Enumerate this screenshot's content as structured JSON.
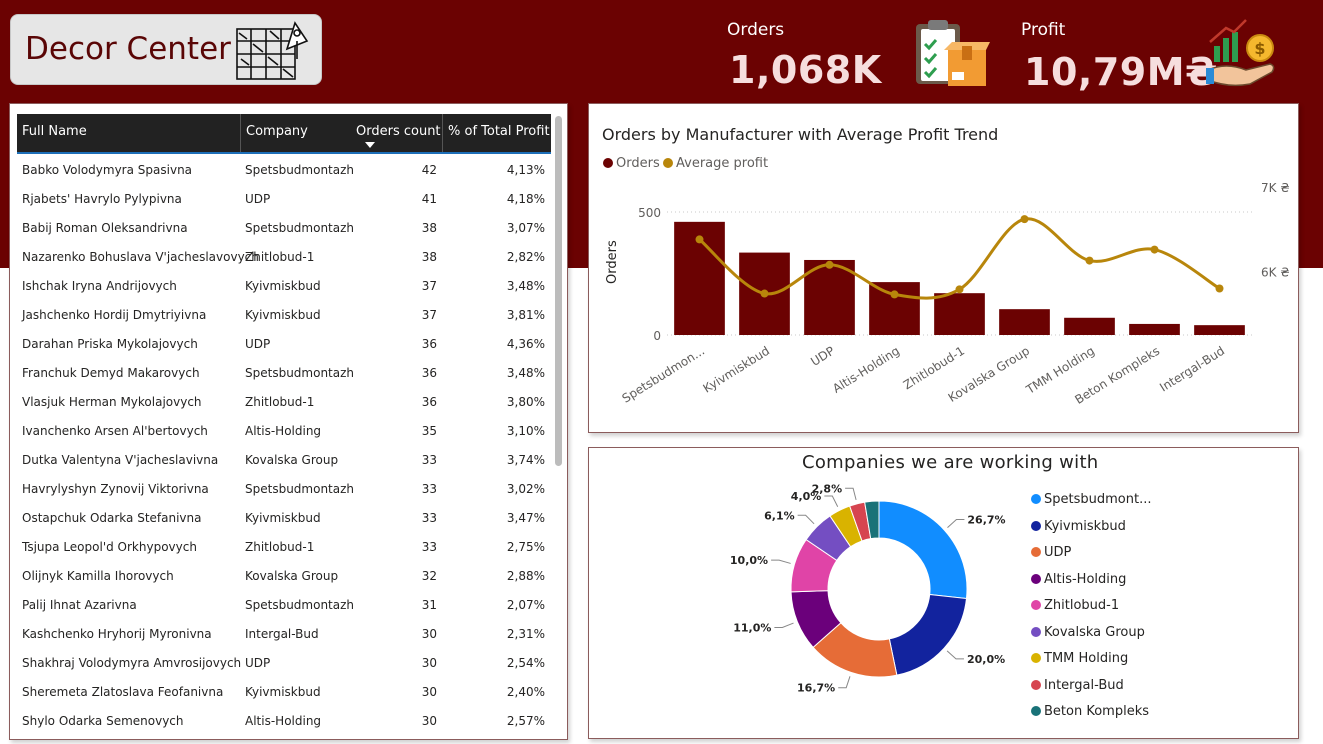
{
  "header": {
    "title": "Decor Center",
    "kpis": [
      {
        "label": "Orders",
        "value": "1,068K"
      },
      {
        "label": "Profit",
        "value": "10,79M₴"
      }
    ]
  },
  "table": {
    "columns": [
      "Full Name",
      "Company",
      "Orders count",
      "% of Total Profit"
    ],
    "rows": [
      [
        "Babko Volodymyra Spasivna",
        "Spetsbudmontazh",
        "42",
        "4,13%"
      ],
      [
        "Rjabets' Havrylo Pylypivna",
        "UDP",
        "41",
        "4,18%"
      ],
      [
        "Babij Roman Oleksandrivna",
        "Spetsbudmontazh",
        "38",
        "3,07%"
      ],
      [
        "Nazarenko Bohuslava V'jacheslavovych",
        "Zhitlobud-1",
        "38",
        "2,82%"
      ],
      [
        "Ishchak Iryna Andrijovych",
        "Kyivmiskbud",
        "37",
        "3,48%"
      ],
      [
        "Jashchenko Hordij Dmytriyivna",
        "Kyivmiskbud",
        "37",
        "3,81%"
      ],
      [
        "Darahan Priska Mykolajovych",
        "UDP",
        "36",
        "4,36%"
      ],
      [
        "Franchuk Demyd Makarovych",
        "Spetsbudmontazh",
        "36",
        "3,48%"
      ],
      [
        "Vlasjuk Herman Mykolajovych",
        "Zhitlobud-1",
        "36",
        "3,80%"
      ],
      [
        "Ivanchenko Arsen Al'bertovych",
        "Altis-Holding",
        "35",
        "3,10%"
      ],
      [
        "Dutka Valentyna V'jacheslavivna",
        "Kovalska Group",
        "33",
        "3,74%"
      ],
      [
        "Havrylyshyn Zynovij Viktorivna",
        "Spetsbudmontazh",
        "33",
        "3,02%"
      ],
      [
        "Ostapchuk Odarka Stefanivna",
        "Kyivmiskbud",
        "33",
        "3,47%"
      ],
      [
        "Tsjupa Leopol'd Orkhypovych",
        "Zhitlobud-1",
        "33",
        "2,75%"
      ],
      [
        "Olijnyk Kamilla Ihorovych",
        "Kovalska Group",
        "32",
        "2,88%"
      ],
      [
        "Palij Ihnat Azarivna",
        "Spetsbudmontazh",
        "31",
        "2,07%"
      ],
      [
        "Kashchenko Hryhorij Myronivna",
        "Intergal-Bud",
        "30",
        "2,31%"
      ],
      [
        "Shakhraj Volodymyra Amvrosijovych",
        "UDP",
        "30",
        "2,54%"
      ],
      [
        "Sheremeta Zlatoslava Feofanivna",
        "Kyivmiskbud",
        "30",
        "2,40%"
      ],
      [
        "Shylo Odarka Semenovych",
        "Altis-Holding",
        "30",
        "2,57%"
      ]
    ]
  },
  "chart_data": [
    {
      "type": "bar",
      "title": "Orders by Manufacturer with Average Profit Trend",
      "categories": [
        "Spetsbudmon...",
        "Kyivmiskbud",
        "UDP",
        "Altis-Holding",
        "Zhitlobud-1",
        "Kovalska Group",
        "TMM Holding",
        "Beton Kompleks",
        "Intergal-Bud"
      ],
      "series": [
        {
          "name": "Orders",
          "type": "bar",
          "color": "#6b0202",
          "axis": "left",
          "values": [
            460,
            335,
            305,
            215,
            170,
            105,
            70,
            45,
            40
          ]
        },
        {
          "name": "Average profit",
          "type": "line",
          "color": "#b8860b",
          "axis": "right",
          "values": [
            6380,
            5740,
            6080,
            5730,
            5790,
            6620,
            6130,
            6260,
            5800
          ]
        }
      ],
      "ylabel": "Orders",
      "ylim": [
        0,
        500
      ],
      "yticks": [
        "0",
        "500"
      ],
      "y2ticks": [
        "6K ₴",
        "7K ₴"
      ],
      "y2lim": [
        5250,
        7000
      ],
      "grid": true,
      "legend": "top-left"
    },
    {
      "type": "pie",
      "title": "Companies we are working with",
      "categories": [
        "Spetsbudmont...",
        "Kyivmiskbud",
        "UDP",
        "Altis-Holding",
        "Zhitlobud-1",
        "Kovalska Group",
        "TMM Holding",
        "Intergal-Bud",
        "Beton Kompleks"
      ],
      "values": [
        26.7,
        20.0,
        16.7,
        11.0,
        10.0,
        6.1,
        4.0,
        2.8,
        2.6
      ],
      "data_labels": [
        "26,7%",
        "20,0%",
        "16,7%",
        "11,0%",
        "10,0%",
        "6,1%",
        "4,0%",
        "2,8%",
        ""
      ],
      "colors": [
        "#118dff",
        "#12239e",
        "#e66c37",
        "#6b007b",
        "#e044a7",
        "#744ec2",
        "#d9b300",
        "#d64550",
        "#197278"
      ],
      "legend": "right"
    }
  ]
}
